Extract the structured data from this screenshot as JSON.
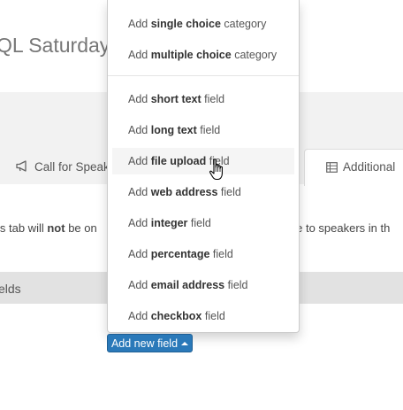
{
  "page": {
    "title_fragment": "QL Saturday"
  },
  "tabs": [
    {
      "label": "Call for Speak",
      "icon": "megaphone-icon"
    },
    {
      "label": "Additional",
      "icon": "table-icon"
    }
  ],
  "notice": {
    "before": "is tab will ",
    "emphasis": "not",
    "after": " be on",
    "right": "ple to speakers in th"
  },
  "section": {
    "title_fragment": "elds"
  },
  "menu": {
    "items": [
      {
        "prefix": "Add ",
        "bold": "single choice",
        "suffix": " category"
      },
      {
        "prefix": "Add ",
        "bold": "multiple choice",
        "suffix": " category"
      },
      {
        "prefix": "Add ",
        "bold": "short text",
        "suffix": " field"
      },
      {
        "prefix": "Add ",
        "bold": "long text",
        "suffix": " field"
      },
      {
        "prefix": "Add ",
        "bold": "file upload",
        "suffix": " field",
        "hovered": true
      },
      {
        "prefix": "Add ",
        "bold": "web address",
        "suffix": " field"
      },
      {
        "prefix": "Add ",
        "bold": "integer",
        "suffix": " field"
      },
      {
        "prefix": "Add ",
        "bold": "percentage",
        "suffix": " field"
      },
      {
        "prefix": "Add ",
        "bold": "email address",
        "suffix": " field"
      },
      {
        "prefix": "Add ",
        "bold": "checkbox",
        "suffix": " field"
      }
    ]
  },
  "button": {
    "label": "Add new field",
    "icon": "caret-up-icon"
  },
  "colors": {
    "button": "#2a79b9",
    "band": "#f2f2f2",
    "fields_bar": "#e2e2e2"
  }
}
